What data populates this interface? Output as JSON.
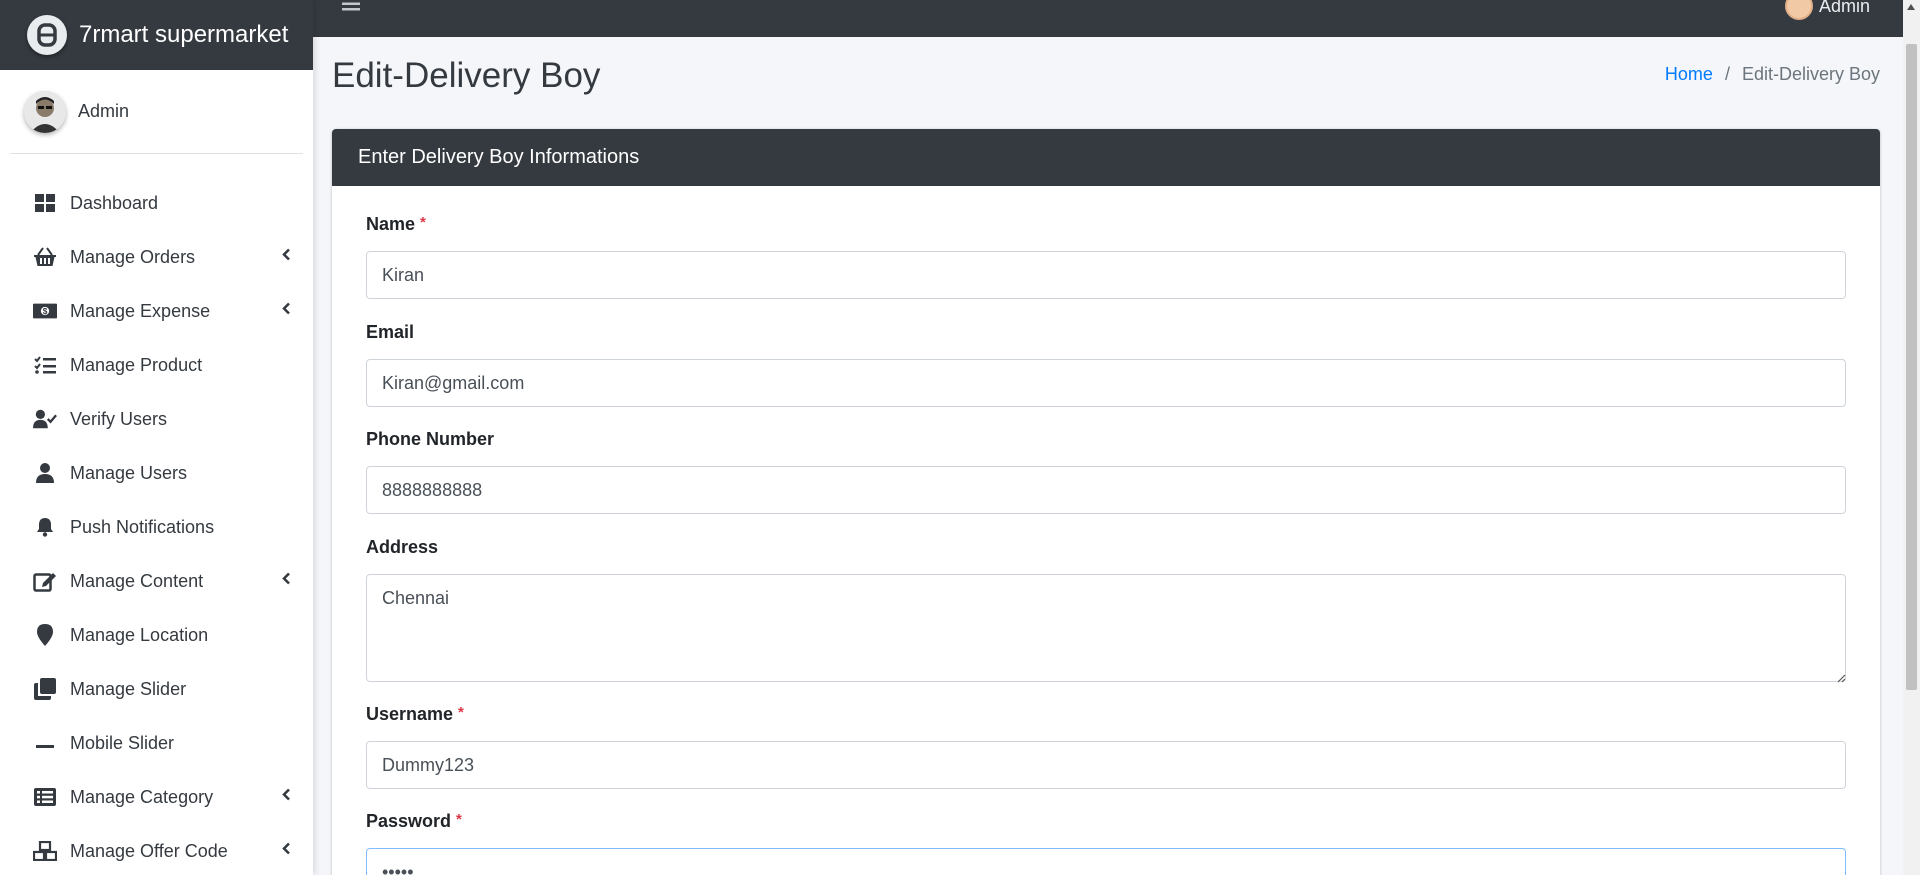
{
  "brand": {
    "name": "7rmart supermarket"
  },
  "sidebar": {
    "user_name": "Admin",
    "items": [
      {
        "label": "Dashboard",
        "icon": "dashboard-icon",
        "has_submenu": false
      },
      {
        "label": "Manage Orders",
        "icon": "basket-icon",
        "has_submenu": true
      },
      {
        "label": "Manage Expense",
        "icon": "money-bill-icon",
        "has_submenu": true
      },
      {
        "label": "Manage Product",
        "icon": "tasks-icon",
        "has_submenu": false
      },
      {
        "label": "Verify Users",
        "icon": "user-check-icon",
        "has_submenu": false
      },
      {
        "label": "Manage Users",
        "icon": "user-icon",
        "has_submenu": false
      },
      {
        "label": "Push Notifications",
        "icon": "bell-icon",
        "has_submenu": false
      },
      {
        "label": "Manage Content",
        "icon": "edit-icon",
        "has_submenu": true
      },
      {
        "label": "Manage Location",
        "icon": "map-marker-icon",
        "has_submenu": false
      },
      {
        "label": "Manage Slider",
        "icon": "clone-icon",
        "has_submenu": false
      },
      {
        "label": "Mobile Slider",
        "icon": "minus-icon",
        "has_submenu": false
      },
      {
        "label": "Manage Category",
        "icon": "list-icon",
        "has_submenu": true
      },
      {
        "label": "Manage Offer Code",
        "icon": "cubes-icon",
        "has_submenu": true
      }
    ]
  },
  "topbar": {
    "user_name": "Admin"
  },
  "page": {
    "title": "Edit-Delivery Boy",
    "breadcrumb": {
      "home": "Home",
      "current": "Edit-Delivery Boy"
    }
  },
  "form": {
    "header": "Enter Delivery Boy Informations",
    "name": {
      "label": "Name",
      "value": "Kiran",
      "required": "*"
    },
    "email": {
      "label": "Email",
      "value": "Kiran@gmail.com"
    },
    "phone": {
      "label": "Phone Number",
      "value": "8888888888"
    },
    "address": {
      "label": "Address",
      "value": "Chennai"
    },
    "username": {
      "label": "Username",
      "value": "Dummy123",
      "required": "*"
    },
    "password": {
      "label": "Password",
      "value": "•••••",
      "required": "*"
    }
  },
  "colors": {
    "sidebar_dark": "#343a40",
    "link": "#007bff",
    "required": "#dc3545",
    "background": "#f4f6f9"
  }
}
